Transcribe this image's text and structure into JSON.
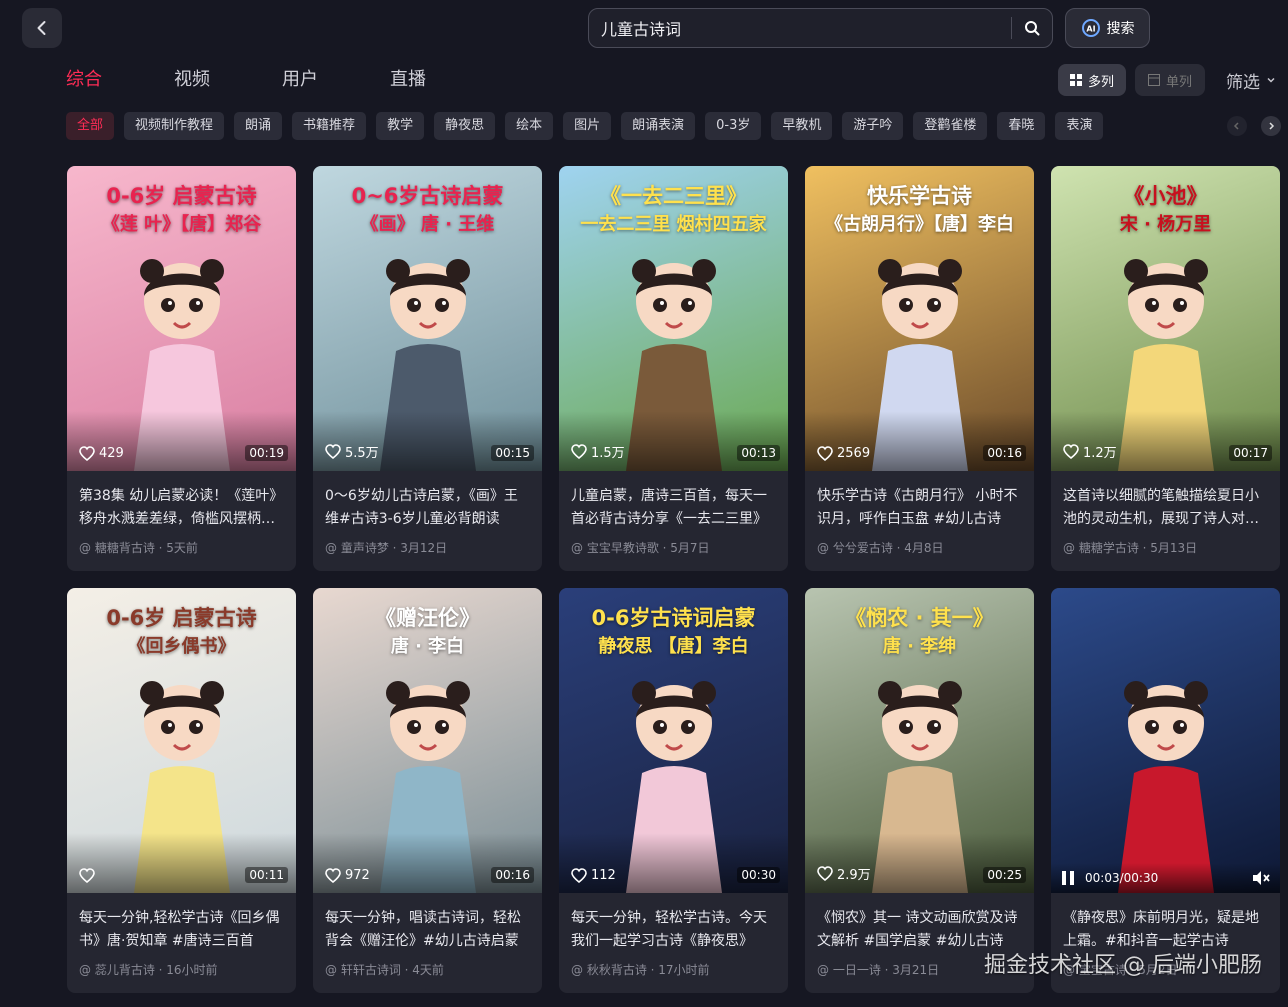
{
  "search": {
    "query": "儿童古诗词",
    "ai_label": "搜索"
  },
  "tabs": [
    {
      "label": "综合",
      "active": true
    },
    {
      "label": "视频",
      "active": false
    },
    {
      "label": "用户",
      "active": false
    },
    {
      "label": "直播",
      "active": false
    }
  ],
  "view": {
    "multi_label": "多列",
    "single_label": "单列",
    "filter_label": "筛选"
  },
  "chips": [
    "全部",
    "视频制作教程",
    "朗诵",
    "书籍推荐",
    "教学",
    "静夜思",
    "绘本",
    "图片",
    "朗诵表演",
    "0-3岁",
    "早教机",
    "游子吟",
    "登鹳雀楼",
    "春晓",
    "表演"
  ],
  "cards": [
    {
      "t1": "0-6岁 启蒙古诗",
      "t2": "《莲 叶》【唐】郑谷",
      "likes": "429",
      "duration": "00:19",
      "desc": "第38集 幼儿启蒙必读！《莲叶》移舟水溅差差绿，倚槛风摆柄柄香",
      "meta": "@ 糖糖背古诗 · 5天前",
      "bg": [
        "#f7b7cc",
        "#d97fa2"
      ],
      "fig": "#f6c7dd",
      "tc": "#e8234f"
    },
    {
      "t1": "0~6岁古诗启蒙",
      "t2": "《画》 唐 · 王维",
      "likes": "5.5万",
      "duration": "00:15",
      "desc": "0～6岁幼儿古诗启蒙，《画》王维#古诗3-6岁儿童必背朗读",
      "meta": "@ 童声诗梦 · 3月12日",
      "bg": [
        "#bfd7df",
        "#6f8f9a"
      ],
      "fig": "#4c5a6b",
      "tc": "#e8234f"
    },
    {
      "t1": "《一去二三里》",
      "t2": "一去二三里 烟村四五家",
      "likes": "1.5万",
      "duration": "00:13",
      "desc": "儿童启蒙，唐诗三百首，每天一首必背古诗分享《一去二三里》",
      "meta": "@ 宝宝早教诗歌 · 5月7日",
      "bg": [
        "#9fd3f0",
        "#6aa84f"
      ],
      "fig": "#7a5a3a",
      "tc": "#ffe14d"
    },
    {
      "t1": "快乐学古诗",
      "t2": "《古朗月行》【唐】李白",
      "likes": "2569",
      "duration": "00:16",
      "desc": "快乐学古诗《古朗月行》 小时不识月，呼作白玉盘 #幼儿古诗",
      "meta": "@ 兮兮爱古诗 · 4月8日",
      "bg": [
        "#f0c060",
        "#6a4a2a"
      ],
      "fig": "#d0d8f0",
      "tc": "#ffffff"
    },
    {
      "t1": "《小池》",
      "t2": "宋 · 杨万里",
      "likes": "1.2万",
      "duration": "00:17",
      "desc": "这首诗以细腻的笔触描绘夏日小池的灵动生机，展现了诗人对自然的热爱",
      "meta": "@ 糖糖学古诗 · 5月13日",
      "bg": [
        "#cfe3b0",
        "#6d8a4a"
      ],
      "fig": "#f3d77a",
      "tc": "#c8101e"
    },
    {
      "t1": "0-6岁 启蒙古诗",
      "t2": "《回乡偶书》",
      "likes": "",
      "duration": "00:11",
      "desc": "每天一分钟,轻松学古诗《回乡偶书》唐·贺知章 #唐诗三百首",
      "meta": "@ 蕊儿背古诗 · 16小时前",
      "bg": [
        "#f4efe6",
        "#cdd8dd"
      ],
      "fig": "#f4e48a",
      "tc": "#8a3a2a"
    },
    {
      "t1": "《赠汪伦》",
      "t2": "唐 · 李白",
      "likes": "972",
      "duration": "00:16",
      "desc": "每天一分钟，唱读古诗词，轻松背会《赠汪伦》#幼儿古诗启蒙",
      "meta": "@ 轩轩古诗词 · 4天前",
      "bg": [
        "#e8d8d0",
        "#7a8e96"
      ],
      "fig": "#8fb6c8",
      "tc": "#ffffff"
    },
    {
      "t1": "0-6岁古诗词启蒙",
      "t2": "静夜思 【唐】李白",
      "likes": "112",
      "duration": "00:30",
      "desc": "每天一分钟，轻松学古诗。今天我们一起学习古诗《静夜思》",
      "meta": "@ 秋秋背古诗 · 17小时前",
      "bg": [
        "#2a3f7a",
        "#1a2240"
      ],
      "fig": "#f2c8d8",
      "tc": "#ffe14d"
    },
    {
      "t1": "《悯农 · 其一》",
      "t2": "唐 · 李绅",
      "likes": "2.9万",
      "duration": "00:25",
      "desc": "《悯农》其一 诗文动画欣赏及诗文解析 #国学启蒙 #幼儿古诗",
      "meta": "@ 一日一诗 · 3月21日",
      "bg": [
        "#b8c4b0",
        "#4a5a3a"
      ],
      "fig": "#d8b890",
      "tc": "#ffe14d"
    },
    {
      "t1": "",
      "t2": "",
      "likes": "",
      "duration": "",
      "playtime": "00:03/00:30",
      "desc": "《静夜思》床前明月光，疑是地上霜。#和抖音一起学古诗",
      "meta": "@ 宝宝古诗 · 5月2日",
      "bg": [
        "#2c4a8a",
        "#0e1834"
      ],
      "fig": "#c8182c",
      "tc": "#ffffff"
    }
  ],
  "watermark": "掘金技术社区 @ 后端小肥肠"
}
